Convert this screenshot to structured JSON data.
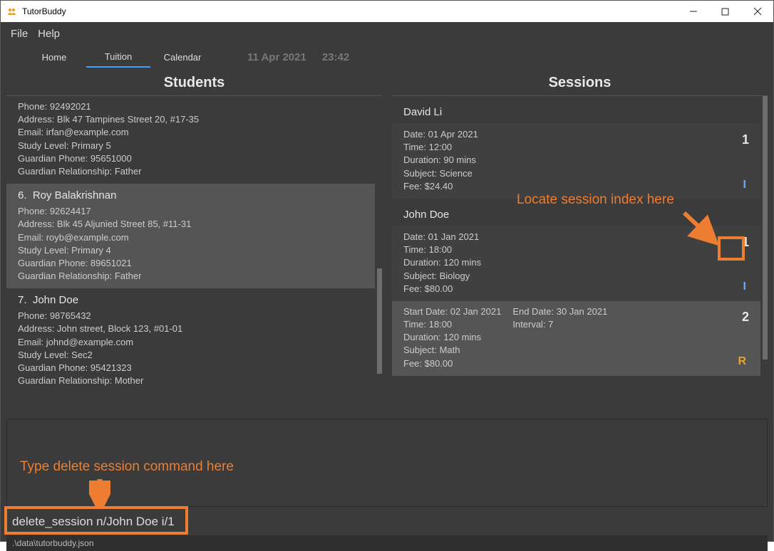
{
  "window": {
    "title": "TutorBuddy"
  },
  "menubar": {
    "file": "File",
    "help": "Help"
  },
  "tabs": {
    "home": "Home",
    "tuition": "Tuition",
    "calendar": "Calendar"
  },
  "datetime": {
    "date": "11 Apr 2021",
    "time": "23:42"
  },
  "columns": {
    "students": "Students",
    "sessions": "Sessions"
  },
  "labels": {
    "phone": "Phone:",
    "address": "Address:",
    "email": "Email:",
    "study": "Study Level:",
    "gphone": "Guardian Phone:",
    "grel": "Guardian Relationship:",
    "date": "Date:",
    "time": "Time:",
    "duration": "Duration:",
    "subject": "Subject:",
    "fee": "Fee:",
    "startdate": "Start Date:",
    "enddate": "End Date:",
    "interval": "Interval:"
  },
  "students": [
    {
      "index": "",
      "name": "",
      "phone": "92492021",
      "address": "Blk 47 Tampines Street 20, #17-35",
      "email": "irfan@example.com",
      "study": "Primary 5",
      "gphone": "95651000",
      "grel": "Father"
    },
    {
      "index": "6.",
      "name": "Roy Balakrishnan",
      "phone": "92624417",
      "address": "Blk 45 Aljunied Street 85, #11-31",
      "email": "royb@example.com",
      "study": "Primary 4",
      "gphone": "89651021",
      "grel": "Father"
    },
    {
      "index": "7.",
      "name": "John Doe",
      "phone": "98765432",
      "address": "John street, Block 123, #01-01",
      "email": "johnd@example.com",
      "study": "Sec2",
      "gphone": "95421323",
      "grel": "Mother"
    }
  ],
  "session_groups": [
    {
      "student": "David Li",
      "sessions": [
        {
          "kind": "single",
          "date": "01 Apr 2021",
          "time": "12:00",
          "duration": "90 mins",
          "subject": "Science",
          "fee": "$24.40",
          "index": "1",
          "flag": "I"
        }
      ]
    },
    {
      "student": "John Doe",
      "sessions": [
        {
          "kind": "single",
          "date": "01 Jan 2021",
          "time": "18:00",
          "duration": "120 mins",
          "subject": "Biology",
          "fee": "$80.00",
          "index": "1",
          "flag": "I"
        },
        {
          "kind": "recurring",
          "startdate": "02 Jan 2021",
          "enddate": "30 Jan 2021",
          "interval": "7",
          "time": "18:00",
          "duration": "120 mins",
          "subject": "Math",
          "fee": "$80.00",
          "index": "2",
          "flag": "R"
        }
      ]
    }
  ],
  "annotations": {
    "session_hint": "Locate session index here",
    "command_hint": "Type delete session command here"
  },
  "command": {
    "value": "delete_session n/John Doe i/1"
  },
  "statusbar": {
    "path": ".\\data\\tutorbuddy.json"
  },
  "colors": {
    "accent": "#ed7d31"
  }
}
